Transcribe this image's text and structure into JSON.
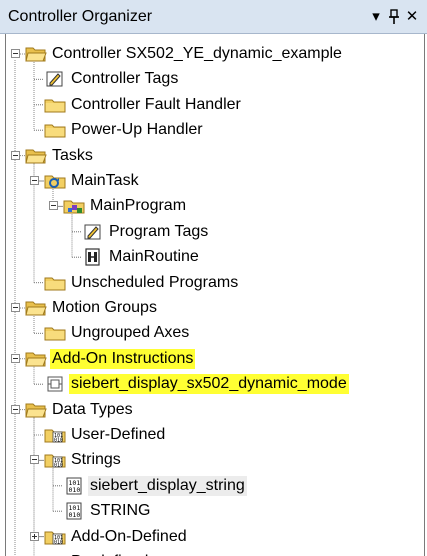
{
  "panel": {
    "title": "Controller Organizer",
    "dropdown_glyph": "▾",
    "pin_glyph": "ᵖ",
    "close_glyph": "✕"
  },
  "tree": [
    {
      "label": "Controller SX502_YE_dynamic_example",
      "icon": "folder-open-icon",
      "expander": "minus"
    },
    {
      "label": "Controller Tags",
      "icon": "tags-icon"
    },
    {
      "label": "Controller Fault Handler",
      "icon": "folder-icon"
    },
    {
      "label": "Power-Up Handler",
      "icon": "folder-icon"
    },
    {
      "label": "Tasks",
      "icon": "folder-open-icon",
      "expander": "minus"
    },
    {
      "label": "MainTask",
      "icon": "task-icon",
      "expander": "minus"
    },
    {
      "label": "MainProgram",
      "icon": "program-icon",
      "expander": "minus"
    },
    {
      "label": "Program Tags",
      "icon": "tags-icon"
    },
    {
      "label": "MainRoutine",
      "icon": "routine-icon"
    },
    {
      "label": "Unscheduled Programs",
      "icon": "folder-icon"
    },
    {
      "label": "Motion Groups",
      "icon": "folder-open-icon",
      "expander": "minus"
    },
    {
      "label": "Ungrouped Axes",
      "icon": "folder-icon"
    },
    {
      "label": "Add-On Instructions",
      "icon": "folder-open-icon",
      "expander": "minus",
      "highlight": true
    },
    {
      "label": "siebert_display_sx502_dynamic_mode",
      "icon": "aoi-icon",
      "highlight": true
    },
    {
      "label": "Data Types",
      "icon": "folder-open-icon",
      "expander": "minus"
    },
    {
      "label": "User-Defined",
      "icon": "datatype-folder-icon"
    },
    {
      "label": "Strings",
      "icon": "datatype-folder-icon",
      "expander": "minus"
    },
    {
      "label": "siebert_display_string",
      "icon": "string-type-icon",
      "selected": true
    },
    {
      "label": "STRING",
      "icon": "string-type-icon"
    },
    {
      "label": "Add-On-Defined",
      "icon": "datatype-folder-icon",
      "expander": "plus"
    },
    {
      "label": "Predefined",
      "icon": "datatype-folder-icon",
      "expander": "plus"
    }
  ],
  "colors": {
    "highlight": "#ffff33",
    "title_bar": "#d9e4f1",
    "folder": "#f2cf62",
    "selection": "#ececec"
  }
}
